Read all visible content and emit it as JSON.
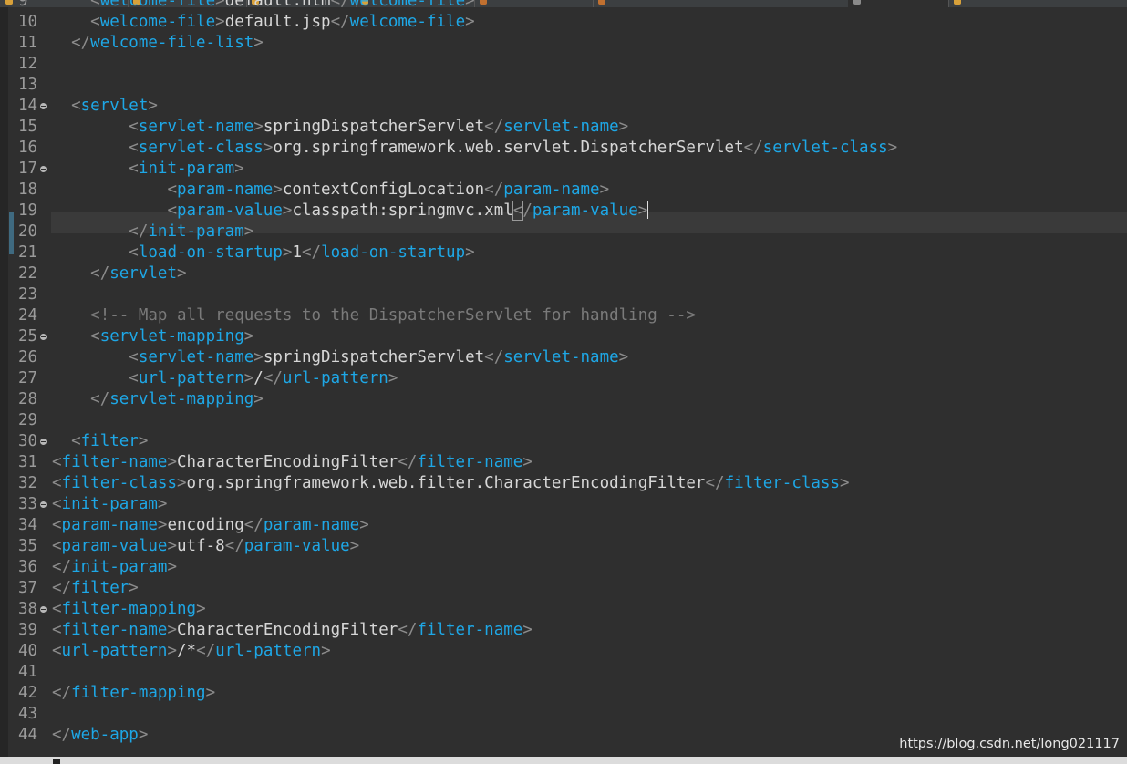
{
  "watermark": "https://blog.csdn.net/long021117",
  "editor": {
    "current_line": 19,
    "lines": [
      {
        "n": "9",
        "indent": "    ",
        "tokens": [
          [
            "p",
            "<"
          ],
          [
            "t",
            "welcome-file"
          ],
          [
            "p",
            ">"
          ],
          [
            "x",
            "default.htm"
          ],
          [
            "p",
            "</"
          ],
          [
            "t",
            "welcome-file"
          ],
          [
            "p",
            ">"
          ]
        ]
      },
      {
        "n": "10",
        "indent": "    ",
        "tokens": [
          [
            "p",
            "<"
          ],
          [
            "t",
            "welcome-file"
          ],
          [
            "p",
            ">"
          ],
          [
            "x",
            "default.jsp"
          ],
          [
            "p",
            "</"
          ],
          [
            "t",
            "welcome-file"
          ],
          [
            "p",
            ">"
          ]
        ]
      },
      {
        "n": "11",
        "indent": "  ",
        "tokens": [
          [
            "p",
            "</"
          ],
          [
            "t",
            "welcome-file-list"
          ],
          [
            "p",
            ">"
          ]
        ]
      },
      {
        "n": "12",
        "indent": "",
        "tokens": []
      },
      {
        "n": "13",
        "indent": "",
        "tokens": []
      },
      {
        "n": "14",
        "fold": true,
        "indent": "  ",
        "tokens": [
          [
            "p",
            "<"
          ],
          [
            "t",
            "servlet"
          ],
          [
            "p",
            ">"
          ]
        ]
      },
      {
        "n": "15",
        "indent": "        ",
        "tokens": [
          [
            "p",
            "<"
          ],
          [
            "t",
            "servlet-name"
          ],
          [
            "p",
            ">"
          ],
          [
            "x",
            "springDispatcherServlet"
          ],
          [
            "p",
            "</"
          ],
          [
            "t",
            "servlet-name"
          ],
          [
            "p",
            ">"
          ]
        ]
      },
      {
        "n": "16",
        "indent": "        ",
        "tokens": [
          [
            "p",
            "<"
          ],
          [
            "t",
            "servlet-class"
          ],
          [
            "p",
            ">"
          ],
          [
            "x",
            "org.springframework.web.servlet.DispatcherServlet"
          ],
          [
            "p",
            "</"
          ],
          [
            "t",
            "servlet-class"
          ],
          [
            "p",
            ">"
          ]
        ]
      },
      {
        "n": "17",
        "fold": true,
        "indent": "        ",
        "tokens": [
          [
            "p",
            "<"
          ],
          [
            "t",
            "init-param"
          ],
          [
            "p",
            ">"
          ]
        ]
      },
      {
        "n": "18",
        "indent": "            ",
        "tokens": [
          [
            "p",
            "<"
          ],
          [
            "t",
            "param-name"
          ],
          [
            "p",
            ">"
          ],
          [
            "x",
            "contextConfigLocation"
          ],
          [
            "p",
            "</"
          ],
          [
            "t",
            "param-name"
          ],
          [
            "p",
            ">"
          ]
        ]
      },
      {
        "n": "19",
        "indent": "            ",
        "tokens": [
          [
            "p",
            "<"
          ],
          [
            "t",
            "param-value"
          ],
          [
            "p",
            ">"
          ],
          [
            "x",
            "classpath:springmvc.xml"
          ],
          [
            "b",
            "<"
          ],
          [
            "p",
            "/"
          ],
          [
            "t",
            "param-value"
          ],
          [
            "p",
            ">"
          ],
          [
            "c",
            ""
          ]
        ]
      },
      {
        "n": "20",
        "indent": "        ",
        "tokens": [
          [
            "p",
            "</"
          ],
          [
            "t",
            "init-param"
          ],
          [
            "p",
            ">"
          ]
        ]
      },
      {
        "n": "21",
        "indent": "        ",
        "tokens": [
          [
            "p",
            "<"
          ],
          [
            "t",
            "load-on-startup"
          ],
          [
            "p",
            ">"
          ],
          [
            "x",
            "1"
          ],
          [
            "p",
            "</"
          ],
          [
            "t",
            "load-on-startup"
          ],
          [
            "p",
            ">"
          ]
        ]
      },
      {
        "n": "22",
        "indent": "    ",
        "tokens": [
          [
            "p",
            "</"
          ],
          [
            "t",
            "servlet"
          ],
          [
            "p",
            ">"
          ]
        ]
      },
      {
        "n": "23",
        "indent": "",
        "tokens": []
      },
      {
        "n": "24",
        "indent": "    ",
        "tokens": [
          [
            "m",
            "<!-- Map all requests to the DispatcherServlet for handling -->"
          ]
        ]
      },
      {
        "n": "25",
        "fold": true,
        "indent": "    ",
        "tokens": [
          [
            "p",
            "<"
          ],
          [
            "t",
            "servlet-mapping"
          ],
          [
            "p",
            ">"
          ]
        ]
      },
      {
        "n": "26",
        "indent": "        ",
        "tokens": [
          [
            "p",
            "<"
          ],
          [
            "t",
            "servlet-name"
          ],
          [
            "p",
            ">"
          ],
          [
            "x",
            "springDispatcherServlet"
          ],
          [
            "p",
            "</"
          ],
          [
            "t",
            "servlet-name"
          ],
          [
            "p",
            ">"
          ]
        ]
      },
      {
        "n": "27",
        "indent": "        ",
        "tokens": [
          [
            "p",
            "<"
          ],
          [
            "t",
            "url-pattern"
          ],
          [
            "p",
            ">"
          ],
          [
            "x",
            "/"
          ],
          [
            "p",
            "</"
          ],
          [
            "t",
            "url-pattern"
          ],
          [
            "p",
            ">"
          ]
        ]
      },
      {
        "n": "28",
        "indent": "    ",
        "tokens": [
          [
            "p",
            "</"
          ],
          [
            "t",
            "servlet-mapping"
          ],
          [
            "p",
            ">"
          ]
        ]
      },
      {
        "n": "29",
        "indent": "",
        "tokens": []
      },
      {
        "n": "30",
        "fold": true,
        "indent": "  ",
        "tokens": [
          [
            "p",
            "<"
          ],
          [
            "t",
            "filter"
          ],
          [
            "p",
            ">"
          ]
        ]
      },
      {
        "n": "31",
        "indent": "",
        "tokens": [
          [
            "p",
            "<"
          ],
          [
            "t",
            "filter-name"
          ],
          [
            "p",
            ">"
          ],
          [
            "x",
            "CharacterEncodingFilter"
          ],
          [
            "p",
            "</"
          ],
          [
            "t",
            "filter-name"
          ],
          [
            "p",
            ">"
          ]
        ]
      },
      {
        "n": "32",
        "indent": "",
        "tokens": [
          [
            "p",
            "<"
          ],
          [
            "t",
            "filter-class"
          ],
          [
            "p",
            ">"
          ],
          [
            "x",
            "org.springframework.web.filter.CharacterEncodingFilter"
          ],
          [
            "p",
            "</"
          ],
          [
            "t",
            "filter-class"
          ],
          [
            "p",
            ">"
          ]
        ]
      },
      {
        "n": "33",
        "fold": true,
        "indent": "",
        "tokens": [
          [
            "p",
            "<"
          ],
          [
            "t",
            "init-param"
          ],
          [
            "p",
            ">"
          ]
        ]
      },
      {
        "n": "34",
        "indent": "",
        "tokens": [
          [
            "p",
            "<"
          ],
          [
            "t",
            "param-name"
          ],
          [
            "p",
            ">"
          ],
          [
            "x",
            "encoding"
          ],
          [
            "p",
            "</"
          ],
          [
            "t",
            "param-name"
          ],
          [
            "p",
            ">"
          ]
        ]
      },
      {
        "n": "35",
        "indent": "",
        "tokens": [
          [
            "p",
            "<"
          ],
          [
            "t",
            "param-value"
          ],
          [
            "p",
            ">"
          ],
          [
            "x",
            "utf-8"
          ],
          [
            "p",
            "</"
          ],
          [
            "t",
            "param-value"
          ],
          [
            "p",
            ">"
          ]
        ]
      },
      {
        "n": "36",
        "indent": "",
        "tokens": [
          [
            "p",
            "</"
          ],
          [
            "t",
            "init-param"
          ],
          [
            "p",
            ">"
          ]
        ]
      },
      {
        "n": "37",
        "indent": "",
        "tokens": [
          [
            "p",
            "</"
          ],
          [
            "t",
            "filter"
          ],
          [
            "p",
            ">"
          ]
        ]
      },
      {
        "n": "38",
        "fold": true,
        "indent": "",
        "tokens": [
          [
            "p",
            "<"
          ],
          [
            "t",
            "filter-mapping"
          ],
          [
            "p",
            ">"
          ]
        ]
      },
      {
        "n": "39",
        "indent": "",
        "tokens": [
          [
            "p",
            "<"
          ],
          [
            "t",
            "filter-name"
          ],
          [
            "p",
            ">"
          ],
          [
            "x",
            "CharacterEncodingFilter"
          ],
          [
            "p",
            "</"
          ],
          [
            "t",
            "filter-name"
          ],
          [
            "p",
            ">"
          ]
        ]
      },
      {
        "n": "40",
        "indent": "",
        "tokens": [
          [
            "p",
            "<"
          ],
          [
            "t",
            "url-pattern"
          ],
          [
            "p",
            ">"
          ],
          [
            "x",
            "/*"
          ],
          [
            "p",
            "</"
          ],
          [
            "t",
            "url-pattern"
          ],
          [
            "p",
            ">"
          ]
        ]
      },
      {
        "n": "41",
        "indent": "",
        "tokens": []
      },
      {
        "n": "42",
        "indent": "",
        "tokens": [
          [
            "p",
            "</"
          ],
          [
            "t",
            "filter-mapping"
          ],
          [
            "p",
            ">"
          ]
        ]
      },
      {
        "n": "43",
        "indent": "",
        "tokens": []
      },
      {
        "n": "44",
        "indent": "",
        "tokens": [
          [
            "p",
            "</"
          ],
          [
            "t",
            "web-app"
          ],
          [
            "p",
            ">"
          ]
        ]
      }
    ]
  },
  "colors": {
    "tag": "#1ea7e6",
    "text": "#d6d6d6",
    "punctuation": "#8c8c8c",
    "comment": "#7a7a7a",
    "background": "#2f2f2f"
  }
}
